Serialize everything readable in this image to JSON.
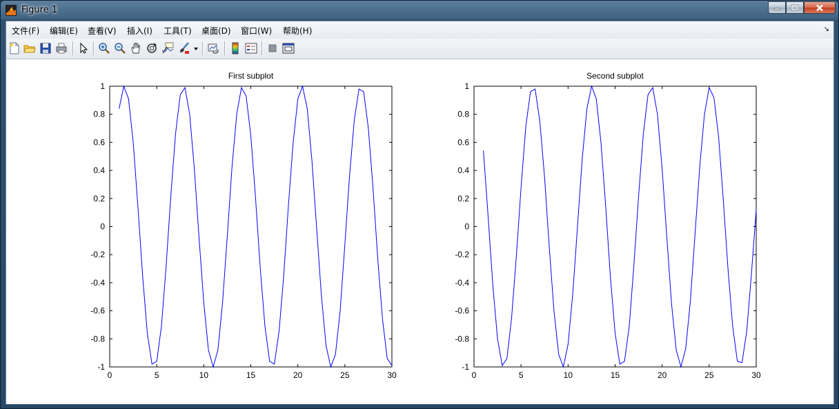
{
  "window": {
    "title": "Figure 1",
    "app_icon": "matlab-logo-icon",
    "buttons": [
      "minimize-icon",
      "maximize-icon",
      "close-icon"
    ]
  },
  "menubar": {
    "items": [
      {
        "label": "文件(F)"
      },
      {
        "label": "编辑(E)"
      },
      {
        "label": "查看(V)"
      },
      {
        "label": "插入(I)"
      },
      {
        "label": "工具(T)"
      },
      {
        "label": "桌面(D)"
      },
      {
        "label": "窗口(W)"
      },
      {
        "label": "帮助(H)"
      }
    ]
  },
  "toolbar": {
    "icons": [
      "new-figure-icon",
      "open-file-icon",
      "save-icon",
      "print-icon",
      "edit-plot-arrow-icon",
      "zoom-in-icon",
      "zoom-out-icon",
      "pan-hand-icon",
      "rotate-3d-icon",
      "data-cursor-icon",
      "brush-icon",
      "brush-dropdown-icon",
      "link-plot-icon",
      "colorbar-icon",
      "legend-icon",
      "hide-plot-tools-icon",
      "show-plot-tools-icon"
    ]
  },
  "colors": {
    "line": "#0000ff",
    "axes": "#000000",
    "background": "#ffffff"
  },
  "chart_data": [
    {
      "type": "line",
      "title": "First subplot",
      "xlabel": "",
      "ylabel": "",
      "xlim": [
        0,
        30
      ],
      "ylim": [
        -1,
        1
      ],
      "xticks": [
        0,
        5,
        10,
        15,
        20,
        25,
        30
      ],
      "yticks": [
        -1,
        -0.8,
        -0.6,
        -0.4,
        -0.2,
        0,
        0.2,
        0.4,
        0.6,
        0.8,
        1
      ],
      "grid": false,
      "series": [
        {
          "x": [
            1,
            1.5,
            2,
            2.5,
            3,
            3.5,
            4,
            4.5,
            5,
            5.5,
            6,
            6.5,
            7,
            7.5,
            8,
            8.5,
            9,
            9.5,
            10,
            10.5,
            11,
            11.5,
            12,
            12.5,
            13,
            13.5,
            14,
            14.5,
            15,
            15.5,
            16,
            16.5,
            17,
            17.5,
            18,
            18.5,
            19,
            19.5,
            20,
            20.5,
            21,
            21.5,
            22,
            22.5,
            23,
            23.5,
            24,
            24.5,
            25,
            25.5,
            26,
            26.5,
            27,
            27.5,
            28,
            28.5,
            29,
            29.5,
            30
          ],
          "y": [
            0.84,
            1.0,
            0.91,
            0.6,
            0.14,
            -0.35,
            -0.76,
            -0.98,
            -0.96,
            -0.71,
            -0.28,
            0.22,
            0.66,
            0.94,
            0.99,
            0.8,
            0.41,
            -0.08,
            -0.54,
            -0.88,
            -1.0,
            -0.88,
            -0.54,
            -0.07,
            0.42,
            0.8,
            0.99,
            0.93,
            0.65,
            0.21,
            -0.29,
            -0.71,
            -0.96,
            -0.98,
            -0.75,
            -0.35,
            0.15,
            0.6,
            0.91,
            1.0,
            0.84,
            0.47,
            -0.01,
            -0.49,
            -0.85,
            -1.0,
            -0.91,
            -0.6,
            -0.13,
            0.36,
            0.76,
            0.98,
            0.96,
            0.7,
            0.27,
            -0.23,
            -0.66,
            -0.94,
            -0.99
          ]
        }
      ]
    },
    {
      "type": "line",
      "title": "Second subplot",
      "xlabel": "",
      "ylabel": "",
      "xlim": [
        0,
        30
      ],
      "ylim": [
        -1,
        1
      ],
      "xticks": [
        0,
        5,
        10,
        15,
        20,
        25,
        30
      ],
      "yticks": [
        -1,
        -0.8,
        -0.6,
        -0.4,
        -0.2,
        0,
        0.2,
        0.4,
        0.6,
        0.8,
        1
      ],
      "grid": false,
      "series": [
        {
          "x": [
            1,
            1.5,
            2,
            2.5,
            3,
            3.5,
            4,
            4.5,
            5,
            5.5,
            6,
            6.5,
            7,
            7.5,
            8,
            8.5,
            9,
            9.5,
            10,
            10.5,
            11,
            11.5,
            12,
            12.5,
            13,
            13.5,
            14,
            14.5,
            15,
            15.5,
            16,
            16.5,
            17,
            17.5,
            18,
            18.5,
            19,
            19.5,
            20,
            20.5,
            21,
            21.5,
            22,
            22.5,
            23,
            23.5,
            24,
            24.5,
            25,
            25.5,
            26,
            26.5,
            27,
            27.5,
            28,
            28.5,
            29,
            29.5,
            30
          ],
          "y": [
            0.54,
            0.07,
            -0.42,
            -0.8,
            -0.99,
            -0.94,
            -0.65,
            -0.21,
            0.28,
            0.71,
            0.96,
            0.98,
            0.75,
            0.35,
            -0.15,
            -0.6,
            -0.91,
            -1.0,
            -0.84,
            -0.48,
            0.0,
            0.48,
            0.84,
            1.0,
            0.91,
            0.6,
            0.14,
            -0.36,
            -0.76,
            -0.98,
            -0.96,
            -0.71,
            -0.27,
            0.22,
            0.66,
            0.94,
            0.99,
            0.8,
            0.41,
            -0.08,
            -0.55,
            -0.88,
            -1.0,
            -0.87,
            -0.53,
            -0.05,
            0.43,
            0.8,
            0.99,
            0.92,
            0.64,
            0.19,
            -0.3,
            -0.71,
            -0.96,
            -0.97,
            -0.74,
            -0.33,
            0.12
          ]
        }
      ]
    }
  ]
}
